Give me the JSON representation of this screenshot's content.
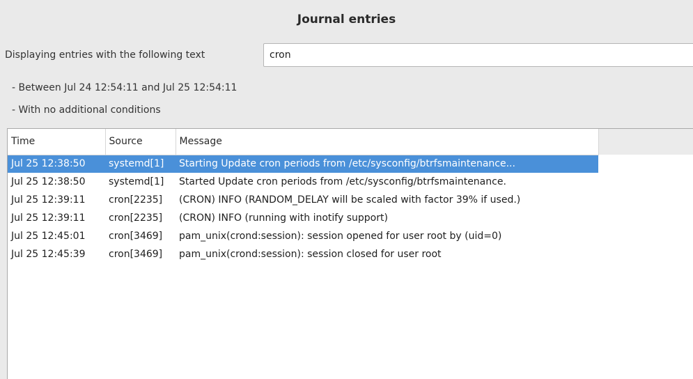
{
  "title": "Journal entries",
  "filter": {
    "label": "Displaying entries with the following text",
    "value": "cron"
  },
  "conditions": [
    "- Between Jul 24 12:54:11 and Jul 25 12:54:11",
    "- With no additional conditions"
  ],
  "table": {
    "columns": [
      "Time",
      "Source",
      "Message"
    ],
    "selected_row": 0,
    "rows": [
      {
        "time": "Jul 25 12:38:50",
        "source": "systemd[1]",
        "message": "Starting Update cron periods from /etc/sysconfig/btrfsmaintenance..."
      },
      {
        "time": "Jul 25 12:38:50",
        "source": "systemd[1]",
        "message": "Started Update cron periods from /etc/sysconfig/btrfsmaintenance."
      },
      {
        "time": "Jul 25 12:39:11",
        "source": "cron[2235]",
        "message": "(CRON) INFO (RANDOM_DELAY will be scaled with factor 39% if used.)"
      },
      {
        "time": "Jul 25 12:39:11",
        "source": "cron[2235]",
        "message": "(CRON) INFO (running with inotify support)"
      },
      {
        "time": "Jul 25 12:45:01",
        "source": "cron[3469]",
        "message": "pam_unix(crond:session): session opened for user root by (uid=0)"
      },
      {
        "time": "Jul 25 12:45:39",
        "source": "cron[3469]",
        "message": "pam_unix(crond:session): session closed for user root"
      }
    ]
  },
  "colors": {
    "background": "#eaeaea",
    "selection": "#4a90d9",
    "panel": "#ffffff"
  }
}
